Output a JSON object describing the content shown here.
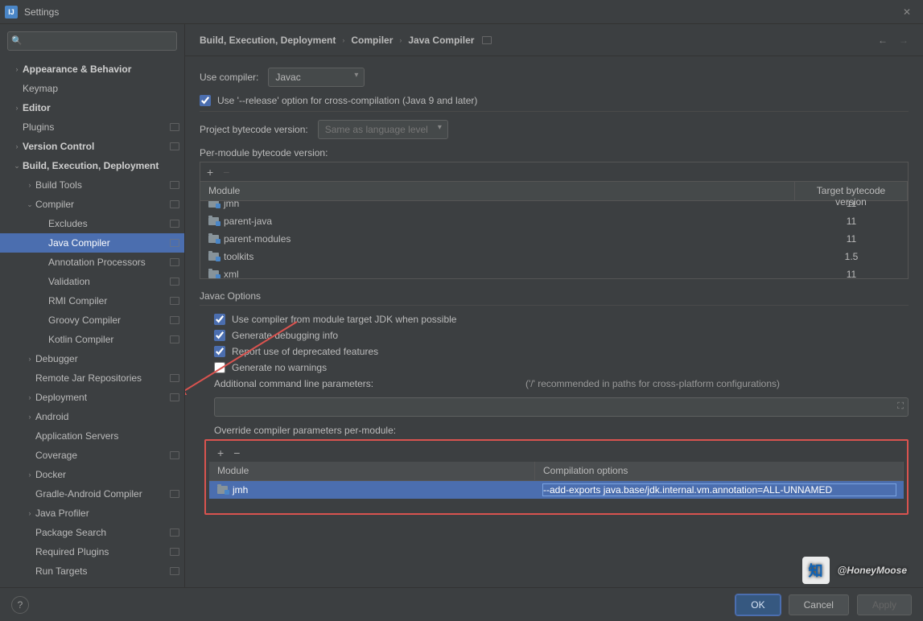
{
  "window": {
    "title": "Settings"
  },
  "search": {
    "placeholder": ""
  },
  "breadcrumb": [
    "Build, Execution, Deployment",
    "Compiler",
    "Java Compiler"
  ],
  "sidebar": [
    {
      "label": "Appearance & Behavior",
      "depth": 0,
      "arrow": "›",
      "bold": true
    },
    {
      "label": "Keymap",
      "depth": 0,
      "arrow": ""
    },
    {
      "label": "Editor",
      "depth": 0,
      "arrow": "›",
      "bold": true
    },
    {
      "label": "Plugins",
      "depth": 0,
      "arrow": "",
      "badge": true
    },
    {
      "label": "Version Control",
      "depth": 0,
      "arrow": "›",
      "bold": true,
      "badge": true
    },
    {
      "label": "Build, Execution, Deployment",
      "depth": 0,
      "arrow": "⌄",
      "bold": true
    },
    {
      "label": "Build Tools",
      "depth": 1,
      "arrow": "›",
      "badge": true
    },
    {
      "label": "Compiler",
      "depth": 1,
      "arrow": "⌄",
      "badge": true
    },
    {
      "label": "Excludes",
      "depth": 2,
      "arrow": "",
      "badge": true
    },
    {
      "label": "Java Compiler",
      "depth": 2,
      "arrow": "",
      "badge": true,
      "sel": true
    },
    {
      "label": "Annotation Processors",
      "depth": 2,
      "arrow": "",
      "badge": true
    },
    {
      "label": "Validation",
      "depth": 2,
      "arrow": "",
      "badge": true
    },
    {
      "label": "RMI Compiler",
      "depth": 2,
      "arrow": "",
      "badge": true
    },
    {
      "label": "Groovy Compiler",
      "depth": 2,
      "arrow": "",
      "badge": true
    },
    {
      "label": "Kotlin Compiler",
      "depth": 2,
      "arrow": "",
      "badge": true
    },
    {
      "label": "Debugger",
      "depth": 1,
      "arrow": "›"
    },
    {
      "label": "Remote Jar Repositories",
      "depth": 1,
      "arrow": "",
      "badge": true
    },
    {
      "label": "Deployment",
      "depth": 1,
      "arrow": "›",
      "badge": true
    },
    {
      "label": "Android",
      "depth": 1,
      "arrow": "›"
    },
    {
      "label": "Application Servers",
      "depth": 1,
      "arrow": ""
    },
    {
      "label": "Coverage",
      "depth": 1,
      "arrow": "",
      "badge": true
    },
    {
      "label": "Docker",
      "depth": 1,
      "arrow": "›"
    },
    {
      "label": "Gradle-Android Compiler",
      "depth": 1,
      "arrow": "",
      "badge": true
    },
    {
      "label": "Java Profiler",
      "depth": 1,
      "arrow": "›"
    },
    {
      "label": "Package Search",
      "depth": 1,
      "arrow": "",
      "badge": true
    },
    {
      "label": "Required Plugins",
      "depth": 1,
      "arrow": "",
      "badge": true
    },
    {
      "label": "Run Targets",
      "depth": 1,
      "arrow": "",
      "badge": true
    }
  ],
  "panel": {
    "useCompilerLabel": "Use compiler:",
    "useCompilerValue": "Javac",
    "releaseOption": "Use '--release' option for cross-compilation (Java 9 and later)",
    "projectBytecodeLabel": "Project bytecode version:",
    "projectBytecodePlaceholder": "Same as language level",
    "perModuleLabel": "Per-module bytecode version:",
    "moduleTable": {
      "headers": [
        "Module",
        "Target bytecode version"
      ],
      "rows": [
        {
          "name": "jmh",
          "ver": "11"
        },
        {
          "name": "parent-java",
          "ver": "11"
        },
        {
          "name": "parent-modules",
          "ver": "11"
        },
        {
          "name": "toolkits",
          "ver": "1.5"
        },
        {
          "name": "xml",
          "ver": "11"
        }
      ]
    },
    "javacOptionsTitle": "Javac Options",
    "javacOptions": [
      {
        "label": "Use compiler from module target JDK when possible",
        "checked": true
      },
      {
        "label": "Generate debugging info",
        "checked": true
      },
      {
        "label": "Report use of deprecated features",
        "checked": true
      },
      {
        "label": "Generate no warnings",
        "checked": false
      }
    ],
    "additionalParamsLabel": "Additional command line parameters:",
    "additionalParamsHint": "('/' recommended in paths for cross-platform configurations)",
    "overrideLabel": "Override compiler parameters per-module:",
    "overrideTable": {
      "headers": [
        "Module",
        "Compilation options"
      ],
      "rows": [
        {
          "name": "jmh",
          "opt": "--add-exports java.base/jdk.internal.vm.annotation=ALL-UNNAMED"
        }
      ]
    }
  },
  "footer": {
    "ok": "OK",
    "cancel": "Cancel",
    "apply": "Apply"
  },
  "watermark": "@HoneyMoose"
}
